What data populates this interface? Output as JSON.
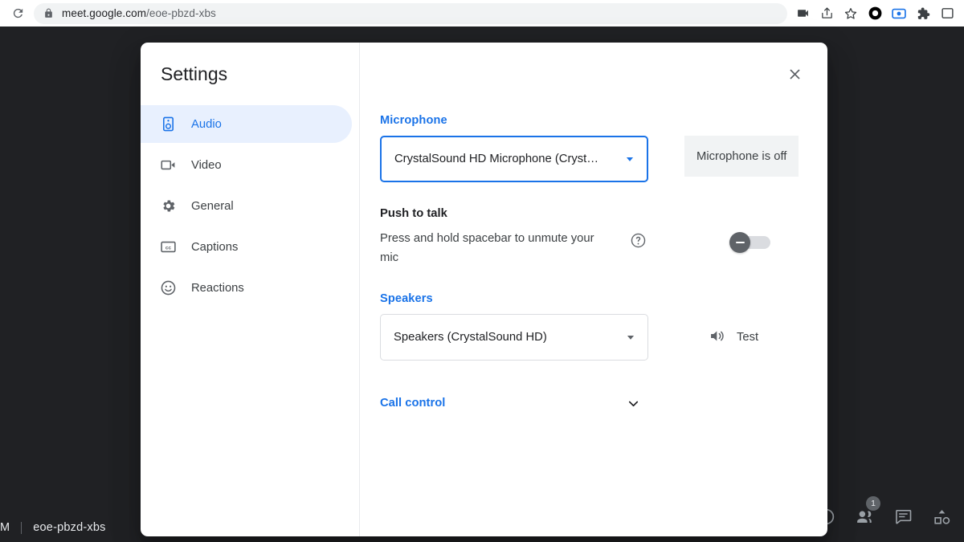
{
  "browser": {
    "reload_icon": "reload-icon",
    "lock_icon": "lock-icon",
    "url_host": "meet.google.com",
    "url_path": "/eoe-pbzd-xbs",
    "url_full": "meet.google.com/eoe-pbzd-xbs",
    "toolbar_icons": [
      {
        "name": "video-camera-icon"
      },
      {
        "name": "share-icon"
      },
      {
        "name": "bookmark-star-icon"
      },
      {
        "name": "record-circle-icon"
      },
      {
        "name": "screen-capture-icon"
      },
      {
        "name": "extensions-puzzle-icon"
      },
      {
        "name": "browser-panel-icon"
      }
    ]
  },
  "meet": {
    "time": "M",
    "meeting_code": "eoe-pbzd-xbs",
    "controls": [
      {
        "name": "meeting-details-icon",
        "badge": ""
      },
      {
        "name": "people-icon",
        "badge": "1"
      },
      {
        "name": "chat-icon",
        "badge": ""
      },
      {
        "name": "activities-icon",
        "badge": ""
      }
    ]
  },
  "dialog": {
    "title": "Settings",
    "close_label": "Close",
    "sidebar": {
      "items": [
        {
          "label": "Audio",
          "icon": "speaker-box-icon",
          "active": true
        },
        {
          "label": "Video",
          "icon": "video-camera-icon",
          "active": false
        },
        {
          "label": "General",
          "icon": "gear-icon",
          "active": false
        },
        {
          "label": "Captions",
          "icon": "closed-captions-icon",
          "active": false
        },
        {
          "label": "Reactions",
          "icon": "smiley-face-icon",
          "active": false
        }
      ]
    },
    "audio": {
      "microphone_label": "Microphone",
      "microphone_value": "CrystalSound HD Microphone (Cryst…",
      "microphone_status": "Microphone is off",
      "push_to_talk_title": "Push to talk",
      "push_to_talk_desc": "Press and hold spacebar to unmute your mic",
      "push_to_talk_help_icon": "help-circle-icon",
      "push_to_talk_enabled": "off",
      "speakers_label": "Speakers",
      "speakers_value": "Speakers (CrystalSound HD)",
      "speakers_test_label": "Test",
      "speakers_test_icon": "volume-up-icon",
      "call_control_label": "Call control",
      "call_control_chevron": "chevron-down-icon"
    }
  },
  "colors": {
    "accent_blue": "#1a73e8",
    "active_pill": "#e8f0fe",
    "page_dark": "#202124",
    "status_bg": "#f1f3f4"
  }
}
